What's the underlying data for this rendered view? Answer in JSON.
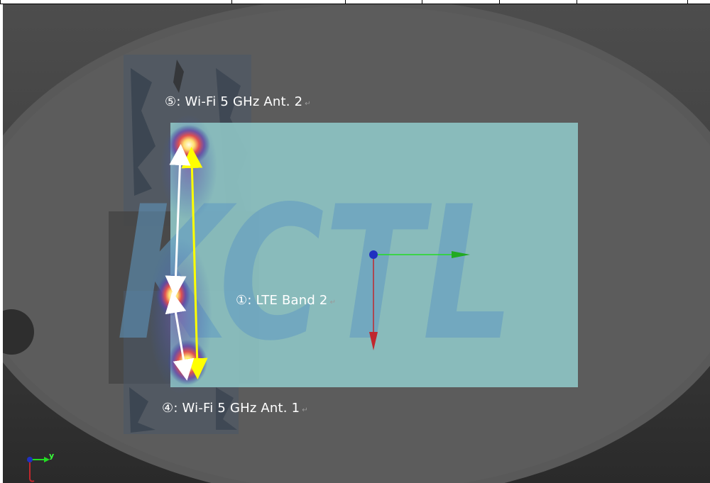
{
  "labels": {
    "wifi_ant2": "⑤: Wi-Fi 5 GHz Ant. 2",
    "lte_band2": "①: LTE Band 2",
    "wifi_ant1": "④: Wi-Fi 5 GHz Ant. 1",
    "return_mark": "↵"
  },
  "watermark": "KCTL",
  "axis_indicator": {
    "y_label": "y"
  },
  "colors": {
    "phantom": "#5a5a5a",
    "device_panel": "#8bc0c0",
    "watermark": "#5f99c2",
    "arrow_yellow": "#ffff00",
    "arrow_white": "#ffffff",
    "axis_green": "#22dd22",
    "axis_red": "#c0272d",
    "origin_blue": "#2030c0"
  }
}
